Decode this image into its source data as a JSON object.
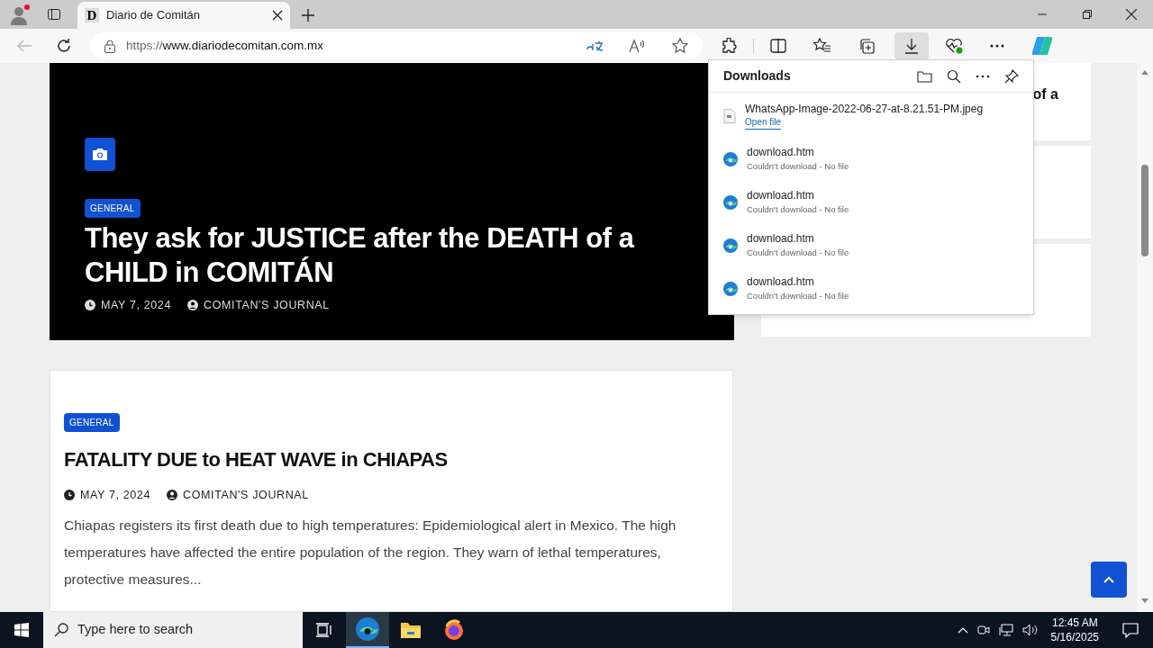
{
  "browser": {
    "tab": {
      "favicon": "D",
      "title": "Diario de Comitán"
    },
    "url": {
      "scheme": "https://",
      "host": "www.diariodecomitan.com.mx"
    }
  },
  "downloads": {
    "title": "Downloads",
    "items": [
      {
        "kind": "file",
        "name": "WhatsApp-Image-2022-06-27-at-8.21.51-PM.jpeg",
        "action": "Open file"
      },
      {
        "kind": "failed",
        "name": "download.htm",
        "status": "Couldn't download - No file"
      },
      {
        "kind": "failed",
        "name": "download.htm",
        "status": "Couldn't download - No file"
      },
      {
        "kind": "failed",
        "name": "download.htm",
        "status": "Couldn't download - No file"
      },
      {
        "kind": "failed",
        "name": "download.htm",
        "status": "Couldn't download - No file"
      }
    ]
  },
  "hero": {
    "category": "GENERAL",
    "title": "They ask for JUSTICE after the DEATH of a CHILD in COMITÁN",
    "date": "MAY 7, 2024",
    "author": "COMITAN'S JOURNAL"
  },
  "post": {
    "category": "GENERAL",
    "title": "FATALITY DUE to HEAT WAVE in CHIAPAS",
    "date": "MAY 7, 2024",
    "author": "COMITAN'S JOURNAL",
    "excerpt": "Chiapas registers its first death due to high temperatures: Epidemiological alert in Mexico. The high temperatures have affected the entire population of the region. They warn of lethal temperatures, protective measures..."
  },
  "sidebar": {
    "snippet": "of a"
  },
  "taskbar": {
    "search_placeholder": "Type here to search",
    "time": "12:45 AM",
    "date": "5/16/2025",
    "apps": [
      {
        "kind": "taskview",
        "selected": false
      },
      {
        "kind": "edge",
        "selected": true
      },
      {
        "kind": "explorer",
        "selected": false
      },
      {
        "kind": "firefox",
        "selected": false
      }
    ]
  }
}
